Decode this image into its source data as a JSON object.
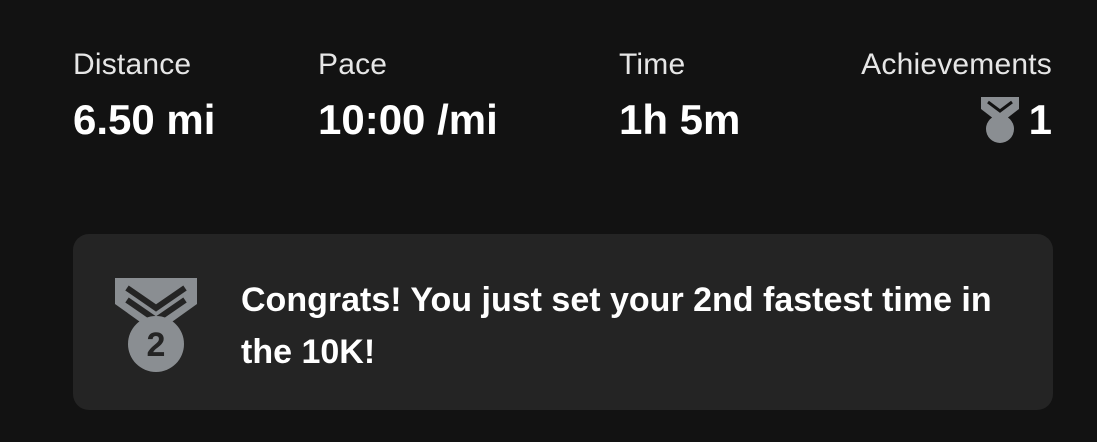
{
  "stats": {
    "distance": {
      "label": "Distance",
      "value": "6.50 mi"
    },
    "pace": {
      "label": "Pace",
      "value": "10:00 /mi"
    },
    "time": {
      "label": "Time",
      "value": "1h 5m"
    },
    "achievements": {
      "label": "Achievements",
      "value": "1",
      "icon": "medal-icon"
    }
  },
  "banner": {
    "icon": "second-place-medal-icon",
    "medal_number": "2",
    "message": "Congrats! You just set your 2nd fastest time in the 10K!"
  },
  "colors": {
    "background": "#121212",
    "banner_background": "#242424",
    "medal_gray": "#8a8e92",
    "text": "#ffffff"
  }
}
